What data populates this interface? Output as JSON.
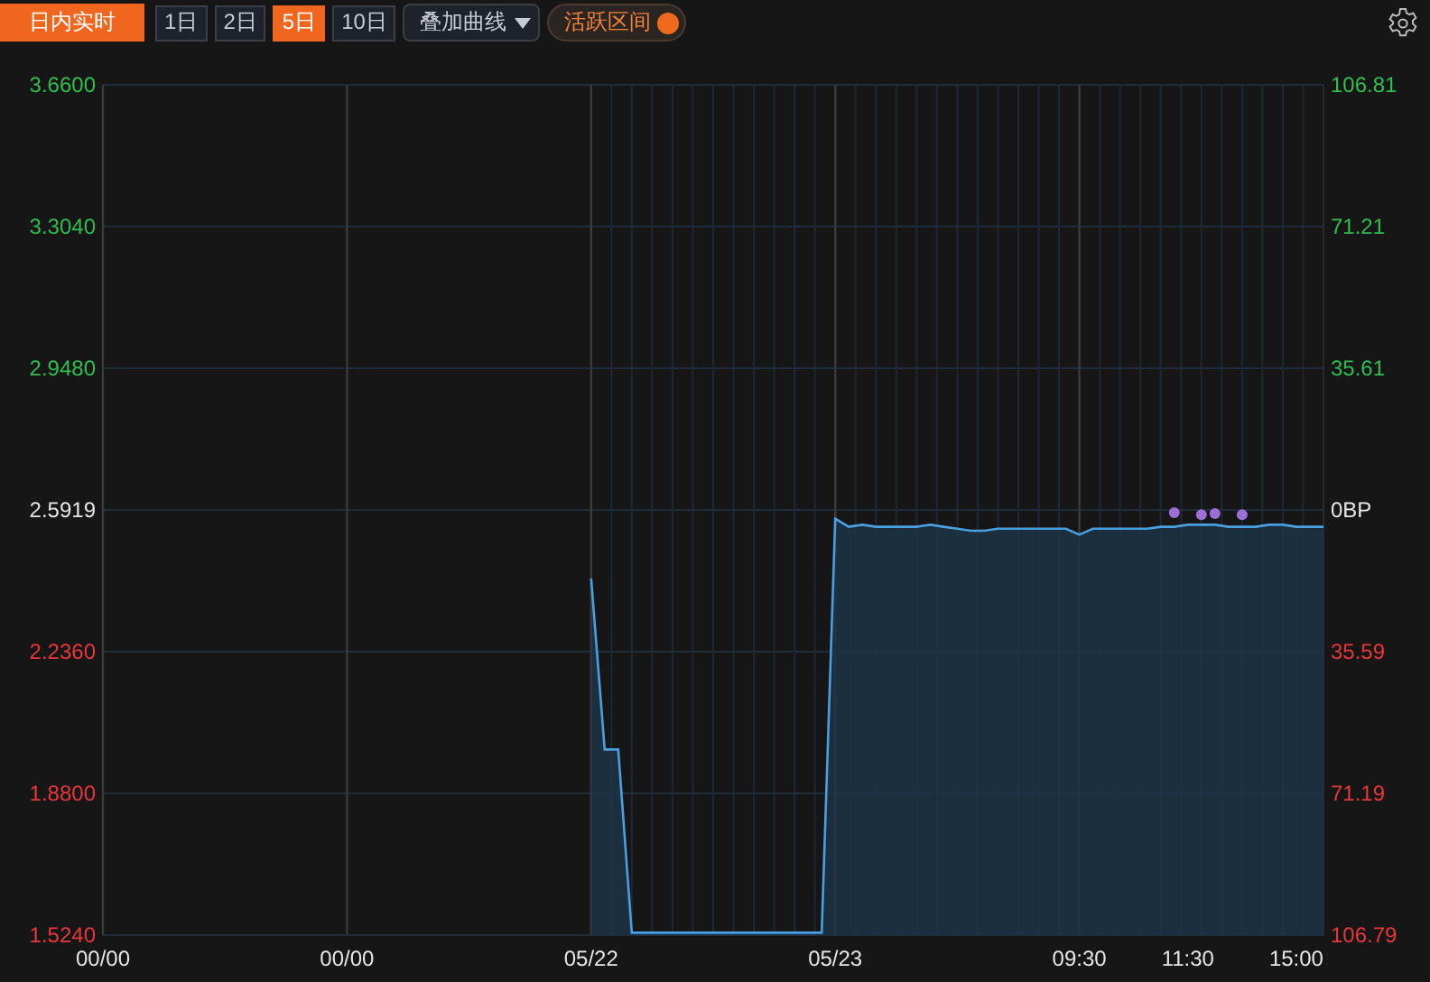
{
  "toolbar": {
    "mode_button": {
      "label": "日内实时",
      "selected": true
    },
    "ranges": [
      {
        "label": "1日",
        "selected": false
      },
      {
        "label": "2日",
        "selected": false
      },
      {
        "label": "5日",
        "selected": true
      },
      {
        "label": "10日",
        "selected": false
      }
    ],
    "overlay_dropdown": {
      "label": "叠加曲线"
    },
    "active_range_toggle": {
      "label": "活跃区间",
      "on": true
    }
  },
  "chart": {
    "chart_data": {
      "type": "area",
      "grid": true,
      "ylim": [
        1.524,
        3.66
      ],
      "categories": [
        "00/00",
        null,
        null,
        null,
        null,
        null,
        null,
        null,
        null,
        null,
        null,
        null,
        null,
        null,
        null,
        null,
        null,
        null,
        "00/00",
        null,
        null,
        null,
        null,
        null,
        null,
        null,
        null,
        null,
        null,
        null,
        null,
        null,
        null,
        null,
        null,
        null,
        "05/22",
        null,
        null,
        null,
        null,
        null,
        null,
        null,
        null,
        null,
        null,
        null,
        null,
        null,
        null,
        null,
        null,
        null,
        "05/23",
        null,
        null,
        null,
        null,
        null,
        null,
        null,
        null,
        null,
        null,
        null,
        null,
        null,
        null,
        null,
        null,
        null,
        "09:30",
        null,
        null,
        null,
        null,
        null,
        null,
        null,
        "11:30",
        null,
        null,
        null,
        null,
        null,
        null,
        null,
        "15:00",
        null,
        null
      ],
      "yticks": [
        {
          "value": 3.66,
          "label": "3.6600"
        },
        {
          "value": 3.304,
          "label": "3.3040"
        },
        {
          "value": 2.948,
          "label": "2.9480"
        },
        {
          "value": 2.5919,
          "label": "2.5919"
        },
        {
          "value": 2.236,
          "label": "2.2360"
        },
        {
          "value": 1.88,
          "label": "1.8800"
        },
        {
          "value": 1.524,
          "label": "1.5240"
        }
      ],
      "series": [
        {
          "color": "#4a9fe0",
          "values": [
            null,
            null,
            null,
            null,
            null,
            null,
            null,
            null,
            null,
            null,
            null,
            null,
            null,
            null,
            null,
            null,
            null,
            null,
            null,
            null,
            null,
            null,
            null,
            null,
            null,
            null,
            null,
            null,
            null,
            null,
            null,
            null,
            null,
            null,
            null,
            null,
            2.42,
            1.99,
            1.99,
            1.53,
            1.53,
            1.53,
            1.53,
            1.53,
            1.53,
            1.53,
            1.53,
            1.53,
            1.53,
            1.53,
            1.53,
            1.53,
            1.53,
            1.53,
            2.57,
            2.55,
            2.555,
            2.55,
            2.55,
            2.55,
            2.55,
            2.555,
            2.55,
            2.545,
            2.54,
            2.54,
            2.545,
            2.545,
            2.545,
            2.545,
            2.545,
            2.545,
            2.53,
            2.545,
            2.545,
            2.545,
            2.545,
            2.545,
            2.55,
            2.55,
            2.555,
            2.555,
            2.555,
            2.55,
            2.55,
            2.55,
            2.555,
            2.555,
            2.55,
            2.55,
            2.55
          ]
        },
        {
          "type": "scatter",
          "color": "#9b6fd6",
          "values": [
            null,
            null,
            null,
            null,
            null,
            null,
            null,
            null,
            null,
            null,
            null,
            null,
            null,
            null,
            null,
            null,
            null,
            null,
            null,
            null,
            null,
            null,
            null,
            null,
            null,
            null,
            null,
            null,
            null,
            null,
            null,
            null,
            null,
            null,
            null,
            null,
            null,
            null,
            null,
            null,
            null,
            null,
            null,
            null,
            null,
            null,
            null,
            null,
            null,
            null,
            null,
            null,
            null,
            null,
            null,
            null,
            null,
            null,
            null,
            null,
            null,
            null,
            null,
            null,
            null,
            null,
            null,
            null,
            null,
            null,
            null,
            null,
            null,
            null,
            null,
            null,
            null,
            null,
            null,
            2.585,
            null,
            2.58,
            2.583,
            null,
            2.58,
            null,
            null,
            null,
            null,
            null,
            null
          ]
        }
      ]
    },
    "right_axis": [
      {
        "label": "106.81",
        "color": "#2fbf4f"
      },
      {
        "label": "71.21",
        "color": "#2fbf4f"
      },
      {
        "label": "35.61",
        "color": "#2fbf4f"
      },
      {
        "label": "0BP",
        "color": "#e6e6e6"
      },
      {
        "label": "35.59",
        "color": "#e8363b"
      },
      {
        "label": "71.19",
        "color": "#e8363b"
      },
      {
        "label": "106.79",
        "color": "#e8363b"
      }
    ]
  }
}
